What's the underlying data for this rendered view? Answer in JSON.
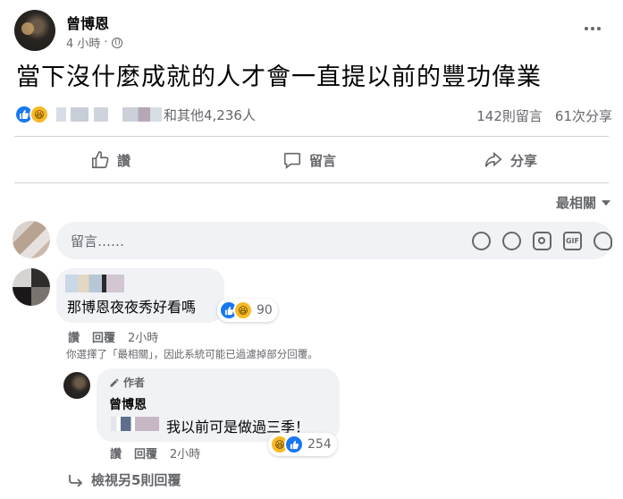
{
  "post": {
    "author": "曾博恩",
    "time": "4 小時",
    "text": "當下沒什麼成就的人才會一直提以前的豐功偉業",
    "reactions_text": "和其他4,236人",
    "comments_count": "142則留言",
    "shares_count": "61次分享",
    "icons": [
      "like-icon",
      "haha-icon",
      "globe-icon",
      "more-icon"
    ]
  },
  "actions": {
    "like": "讚",
    "comment": "留言",
    "share": "分享"
  },
  "sort_label": "最相關",
  "comment_input": {
    "placeholder": "留言……",
    "icons": [
      "emoji-icon",
      "smile-icon",
      "camera-icon",
      "gif-icon",
      "sticker-icon"
    ]
  },
  "comments": [
    {
      "text": "那博恩夜夜秀好看嗎",
      "reaction_count": "90",
      "like": "讚",
      "reply": "回覆",
      "time": "2小時"
    }
  ],
  "filter_notice": "你選擇了「最相關」，因此系統可能已過濾掉部分回覆。",
  "reply": {
    "author_tag": "作者",
    "author": "曾博恩",
    "text": "我以前可是做過三季！",
    "reaction_count": "254",
    "like": "讚",
    "reply": "回覆",
    "time": "2小時"
  },
  "view_more": "檢視另5則回覆",
  "colors": {
    "like_blue": "#1877f2",
    "haha_yellow": "#f7b928",
    "text_secondary": "#65676b",
    "bubble_bg": "#f0f2f5"
  }
}
